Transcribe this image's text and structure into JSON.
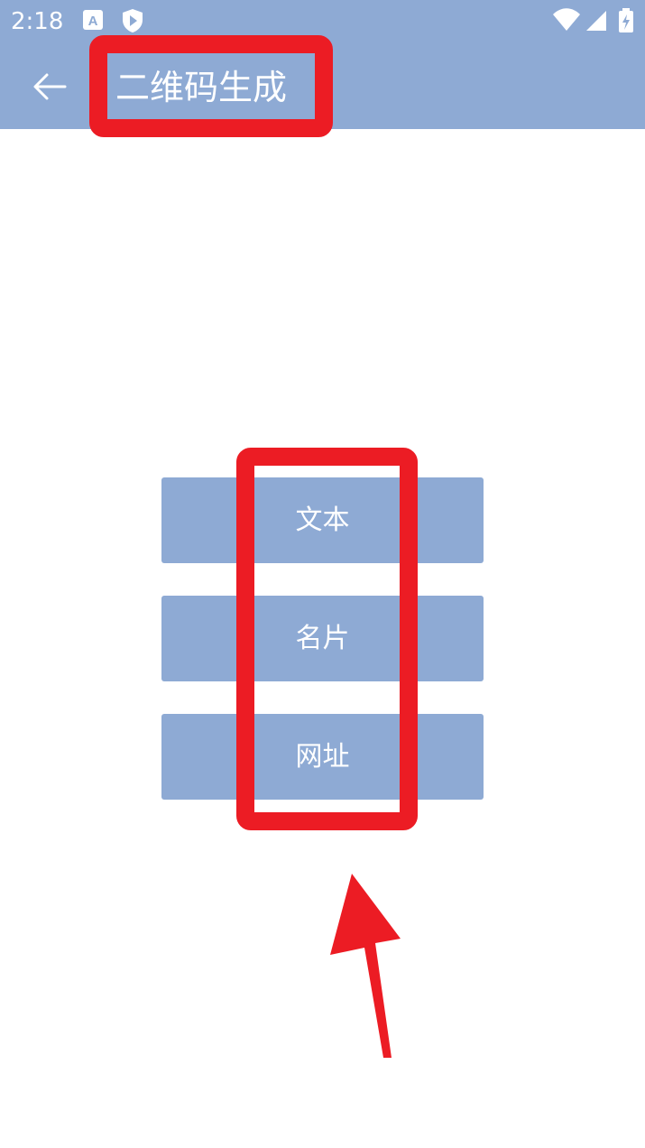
{
  "status_bar": {
    "time": "2:18",
    "icons": [
      "app-a-icon",
      "shield-play-icon",
      "wifi-icon",
      "cellular-signal-icon",
      "battery-charging-icon"
    ]
  },
  "appbar": {
    "back_icon": "arrow-left-icon",
    "title": "二维码生成"
  },
  "options": [
    {
      "label": "文本"
    },
    {
      "label": "名片"
    },
    {
      "label": "网址"
    }
  ],
  "colors": {
    "primary": "#8eaad4",
    "annotation": "#ec1c24",
    "background": "#ffffff"
  }
}
